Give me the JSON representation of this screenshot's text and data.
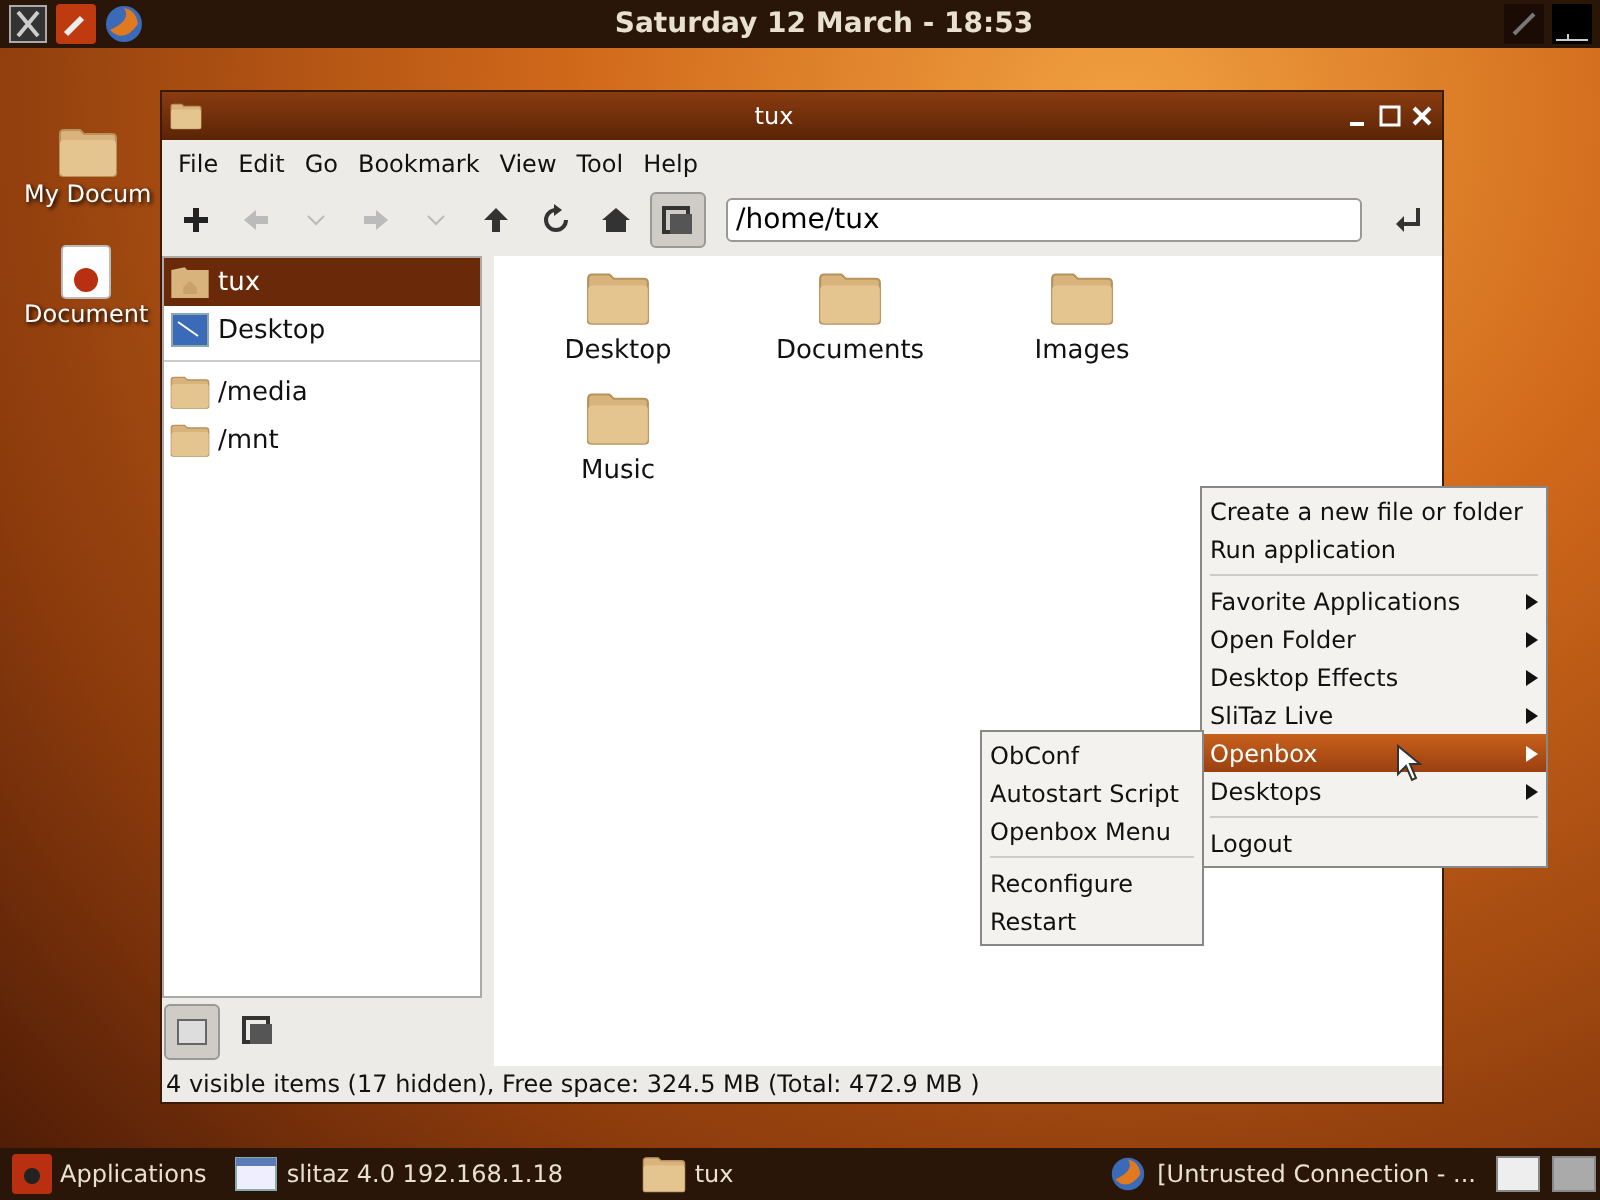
{
  "top_panel": {
    "clock": "Saturday 12 March - 18:53"
  },
  "desktop_icons": [
    {
      "label": "My Docum",
      "kind": "folder"
    },
    {
      "label": "Document",
      "kind": "editor"
    }
  ],
  "window": {
    "title": "tux",
    "menu": [
      "File",
      "Edit",
      "Go",
      "Bookmark",
      "View",
      "Tool",
      "Help"
    ],
    "path": "/home/tux",
    "places": [
      [
        {
          "label": "tux",
          "kind": "home",
          "selected": true
        },
        {
          "label": "Desktop",
          "kind": "desktop",
          "selected": false
        }
      ],
      [
        {
          "label": "/media",
          "kind": "folder",
          "selected": false
        },
        {
          "label": "/mnt",
          "kind": "folder",
          "selected": false
        }
      ]
    ],
    "files": [
      {
        "label": "Desktop"
      },
      {
        "label": "Documents"
      },
      {
        "label": "Images"
      },
      {
        "label": "Music"
      }
    ],
    "status": "4 visible items (17 hidden), Free space: 324.5 MB (Total: 472.9 MB )"
  },
  "context_menu": {
    "sections": [
      [
        {
          "label": "Create a new file or folder",
          "kind": "action",
          "selected": false
        },
        {
          "label": "Run application",
          "kind": "action",
          "selected": false
        }
      ],
      [
        {
          "label": "Favorite Applications",
          "kind": "submenu",
          "selected": false
        },
        {
          "label": "Open Folder",
          "kind": "submenu",
          "selected": false
        },
        {
          "label": "Desktop Effects",
          "kind": "submenu",
          "selected": false
        },
        {
          "label": "SliTaz Live",
          "kind": "submenu",
          "selected": false
        },
        {
          "label": "Openbox",
          "kind": "submenu",
          "selected": true
        },
        {
          "label": "Desktops",
          "kind": "submenu",
          "selected": false
        }
      ],
      [
        {
          "label": "Logout",
          "kind": "action",
          "selected": false
        }
      ]
    ]
  },
  "submenu": {
    "sections": [
      [
        {
          "label": "ObConf",
          "selected": false
        },
        {
          "label": "Autostart Script",
          "selected": false
        },
        {
          "label": "Openbox Menu",
          "selected": false
        }
      ],
      [
        {
          "label": "Reconfigure",
          "selected": false
        },
        {
          "label": "Restart",
          "selected": false
        }
      ]
    ]
  },
  "taskbar": {
    "start": "Applications",
    "tasks": [
      {
        "label": "slitaz 4.0 192.168.1.18",
        "kind": "terminal"
      },
      {
        "label": "tux",
        "kind": "folder"
      },
      {
        "label": "[Untrusted Connection - ...",
        "kind": "browser"
      }
    ]
  }
}
